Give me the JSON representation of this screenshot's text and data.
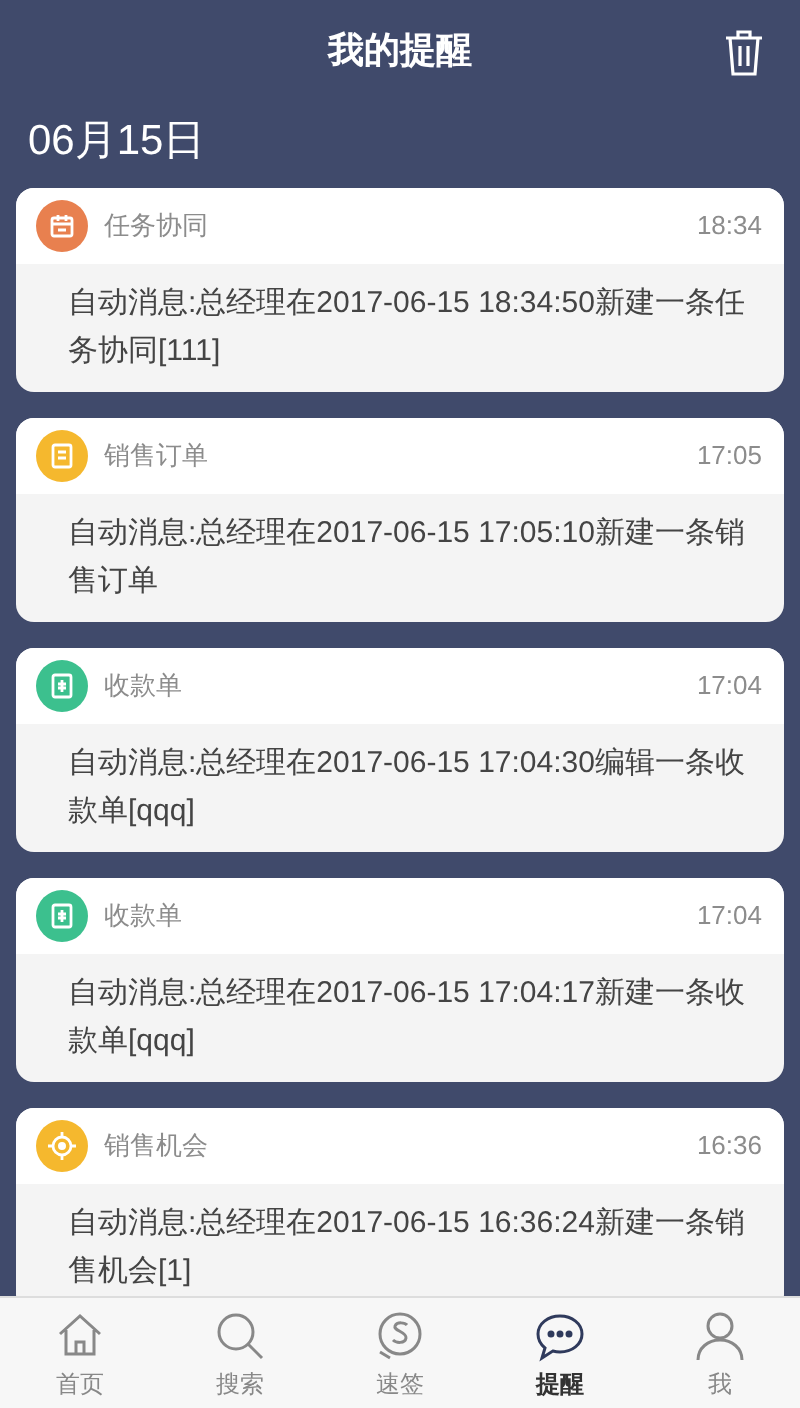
{
  "header": {
    "title": "我的提醒"
  },
  "date": "06月15日",
  "notifications": [
    {
      "kind": "calendar",
      "color": "#e8804f",
      "category": "任务协同",
      "time": "18:34",
      "message": "自动消息:总经理在2017-06-15 18:34:50新建一条任务协同[111]"
    },
    {
      "kind": "order",
      "color": "#f5b82e",
      "category": "销售订单",
      "time": "17:05",
      "message": "自动消息:总经理在2017-06-15 17:05:10新建一条销售订单"
    },
    {
      "kind": "receipt",
      "color": "#3cc08e",
      "category": "收款单",
      "time": "17:04",
      "message": "自动消息:总经理在2017-06-15 17:04:30编辑一条收款单[qqq]"
    },
    {
      "kind": "receipt",
      "color": "#3cc08e",
      "category": "收款单",
      "time": "17:04",
      "message": "自动消息:总经理在2017-06-15 17:04:17新建一条收款单[qqq]"
    },
    {
      "kind": "target",
      "color": "#f5b82e",
      "category": "销售机会",
      "time": "16:36",
      "message": "自动消息:总经理在2017-06-15 16:36:24新建一条销售机会[1]"
    }
  ],
  "tabs": [
    {
      "kind": "home",
      "label": "首页",
      "selected": false
    },
    {
      "kind": "search",
      "label": "搜索",
      "selected": false
    },
    {
      "kind": "sign",
      "label": "速签",
      "selected": false
    },
    {
      "kind": "chat",
      "label": "提醒",
      "selected": true
    },
    {
      "kind": "person",
      "label": "我",
      "selected": false
    }
  ]
}
